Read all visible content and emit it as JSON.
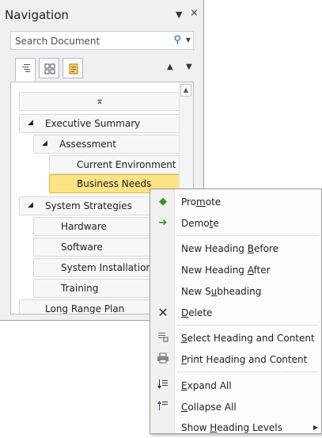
{
  "pane": {
    "title": "Navigation",
    "dropdown_icon": "dropdown-arrow-icon",
    "close_icon": "close-icon",
    "search_placeholder": "Search Document",
    "tabs": [
      {
        "name": "browse-headings",
        "icon": "headings-icon",
        "active": true
      },
      {
        "name": "browse-pages",
        "icon": "pages-grid-icon",
        "active": false
      },
      {
        "name": "browse-results",
        "icon": "results-icon",
        "active": false
      }
    ],
    "prev_icon": "up-arrow-icon",
    "next_icon": "down-arrow-icon",
    "collapse_glyph": "⌅"
  },
  "tree": {
    "items": [
      {
        "label": "Executive Summary"
      },
      {
        "label": "Assessment"
      },
      {
        "label": "Current Environment"
      },
      {
        "label": "Business Needs",
        "selected": true
      },
      {
        "label": "System Strategies"
      },
      {
        "label": "Hardware"
      },
      {
        "label": "Software"
      },
      {
        "label": "System Installation"
      },
      {
        "label": "Training"
      },
      {
        "label": "Long Range Plan"
      }
    ]
  },
  "context_menu": {
    "items": [
      {
        "label": "Promote",
        "pre": "Pro",
        "u": "m",
        "post": "ote",
        "icon": "promote-arrow-icon"
      },
      {
        "label": "Demote",
        "pre": "Demo",
        "u": "t",
        "post": "e",
        "icon": "demote-arrow-icon"
      },
      {
        "label": "New Heading Before",
        "pre": "New Heading ",
        "u": "B",
        "post": "efore"
      },
      {
        "label": "New Heading After",
        "pre": "New Heading ",
        "u": "A",
        "post": "fter"
      },
      {
        "label": "New Subheading",
        "pre": "New S",
        "u": "u",
        "post": "bheading"
      },
      {
        "label": "Delete",
        "pre": "",
        "u": "D",
        "post": "elete",
        "icon": "delete-x-icon"
      },
      {
        "label": "Select Heading and Content",
        "pre": "",
        "u": "S",
        "post": "elect Heading and Content",
        "icon": "select-content-icon"
      },
      {
        "label": "Print Heading and Content",
        "pre": "",
        "u": "P",
        "post": "rint Heading and Content",
        "icon": "printer-icon"
      },
      {
        "label": "Expand All",
        "pre": "",
        "u": "E",
        "post": "xpand All",
        "icon": "expand-all-icon"
      },
      {
        "label": "Collapse All",
        "pre": "",
        "u": "C",
        "post": "ollapse All",
        "icon": "collapse-all-icon"
      },
      {
        "label": "Show Heading Levels",
        "pre": "Show ",
        "u": "H",
        "post": "eading Levels",
        "submenu": true
      }
    ]
  },
  "colors": {
    "selected_fill": "#fce486",
    "selected_border": "#e5b52f",
    "promote_green": "#3c8c2c"
  }
}
